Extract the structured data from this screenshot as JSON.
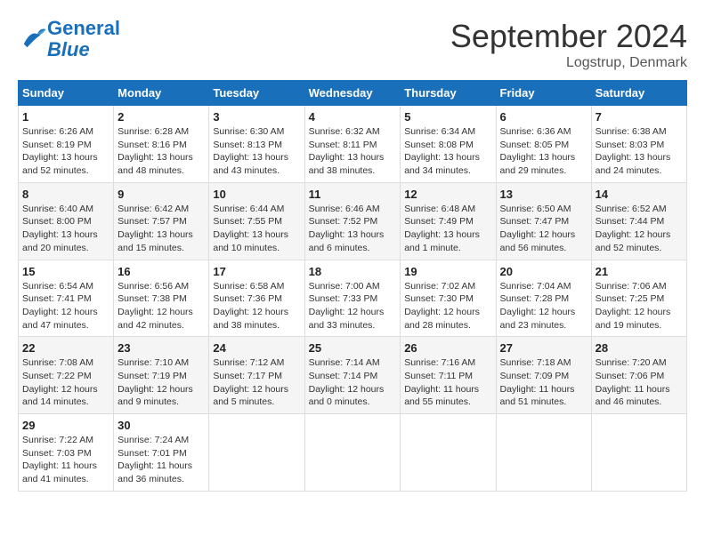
{
  "header": {
    "logo_line1": "General",
    "logo_line2": "Blue",
    "month_title": "September 2024",
    "location": "Logstrup, Denmark"
  },
  "weekdays": [
    "Sunday",
    "Monday",
    "Tuesday",
    "Wednesday",
    "Thursday",
    "Friday",
    "Saturday"
  ],
  "weeks": [
    [
      {
        "day": "1",
        "info": "Sunrise: 6:26 AM\nSunset: 8:19 PM\nDaylight: 13 hours\nand 52 minutes."
      },
      {
        "day": "2",
        "info": "Sunrise: 6:28 AM\nSunset: 8:16 PM\nDaylight: 13 hours\nand 48 minutes."
      },
      {
        "day": "3",
        "info": "Sunrise: 6:30 AM\nSunset: 8:13 PM\nDaylight: 13 hours\nand 43 minutes."
      },
      {
        "day": "4",
        "info": "Sunrise: 6:32 AM\nSunset: 8:11 PM\nDaylight: 13 hours\nand 38 minutes."
      },
      {
        "day": "5",
        "info": "Sunrise: 6:34 AM\nSunset: 8:08 PM\nDaylight: 13 hours\nand 34 minutes."
      },
      {
        "day": "6",
        "info": "Sunrise: 6:36 AM\nSunset: 8:05 PM\nDaylight: 13 hours\nand 29 minutes."
      },
      {
        "day": "7",
        "info": "Sunrise: 6:38 AM\nSunset: 8:03 PM\nDaylight: 13 hours\nand 24 minutes."
      }
    ],
    [
      {
        "day": "8",
        "info": "Sunrise: 6:40 AM\nSunset: 8:00 PM\nDaylight: 13 hours\nand 20 minutes."
      },
      {
        "day": "9",
        "info": "Sunrise: 6:42 AM\nSunset: 7:57 PM\nDaylight: 13 hours\nand 15 minutes."
      },
      {
        "day": "10",
        "info": "Sunrise: 6:44 AM\nSunset: 7:55 PM\nDaylight: 13 hours\nand 10 minutes."
      },
      {
        "day": "11",
        "info": "Sunrise: 6:46 AM\nSunset: 7:52 PM\nDaylight: 13 hours\nand 6 minutes."
      },
      {
        "day": "12",
        "info": "Sunrise: 6:48 AM\nSunset: 7:49 PM\nDaylight: 13 hours\nand 1 minute."
      },
      {
        "day": "13",
        "info": "Sunrise: 6:50 AM\nSunset: 7:47 PM\nDaylight: 12 hours\nand 56 minutes."
      },
      {
        "day": "14",
        "info": "Sunrise: 6:52 AM\nSunset: 7:44 PM\nDaylight: 12 hours\nand 52 minutes."
      }
    ],
    [
      {
        "day": "15",
        "info": "Sunrise: 6:54 AM\nSunset: 7:41 PM\nDaylight: 12 hours\nand 47 minutes."
      },
      {
        "day": "16",
        "info": "Sunrise: 6:56 AM\nSunset: 7:38 PM\nDaylight: 12 hours\nand 42 minutes."
      },
      {
        "day": "17",
        "info": "Sunrise: 6:58 AM\nSunset: 7:36 PM\nDaylight: 12 hours\nand 38 minutes."
      },
      {
        "day": "18",
        "info": "Sunrise: 7:00 AM\nSunset: 7:33 PM\nDaylight: 12 hours\nand 33 minutes."
      },
      {
        "day": "19",
        "info": "Sunrise: 7:02 AM\nSunset: 7:30 PM\nDaylight: 12 hours\nand 28 minutes."
      },
      {
        "day": "20",
        "info": "Sunrise: 7:04 AM\nSunset: 7:28 PM\nDaylight: 12 hours\nand 23 minutes."
      },
      {
        "day": "21",
        "info": "Sunrise: 7:06 AM\nSunset: 7:25 PM\nDaylight: 12 hours\nand 19 minutes."
      }
    ],
    [
      {
        "day": "22",
        "info": "Sunrise: 7:08 AM\nSunset: 7:22 PM\nDaylight: 12 hours\nand 14 minutes."
      },
      {
        "day": "23",
        "info": "Sunrise: 7:10 AM\nSunset: 7:19 PM\nDaylight: 12 hours\nand 9 minutes."
      },
      {
        "day": "24",
        "info": "Sunrise: 7:12 AM\nSunset: 7:17 PM\nDaylight: 12 hours\nand 5 minutes."
      },
      {
        "day": "25",
        "info": "Sunrise: 7:14 AM\nSunset: 7:14 PM\nDaylight: 12 hours\nand 0 minutes."
      },
      {
        "day": "26",
        "info": "Sunrise: 7:16 AM\nSunset: 7:11 PM\nDaylight: 11 hours\nand 55 minutes."
      },
      {
        "day": "27",
        "info": "Sunrise: 7:18 AM\nSunset: 7:09 PM\nDaylight: 11 hours\nand 51 minutes."
      },
      {
        "day": "28",
        "info": "Sunrise: 7:20 AM\nSunset: 7:06 PM\nDaylight: 11 hours\nand 46 minutes."
      }
    ],
    [
      {
        "day": "29",
        "info": "Sunrise: 7:22 AM\nSunset: 7:03 PM\nDaylight: 11 hours\nand 41 minutes."
      },
      {
        "day": "30",
        "info": "Sunrise: 7:24 AM\nSunset: 7:01 PM\nDaylight: 11 hours\nand 36 minutes."
      },
      {
        "day": "",
        "info": ""
      },
      {
        "day": "",
        "info": ""
      },
      {
        "day": "",
        "info": ""
      },
      {
        "day": "",
        "info": ""
      },
      {
        "day": "",
        "info": ""
      }
    ]
  ]
}
